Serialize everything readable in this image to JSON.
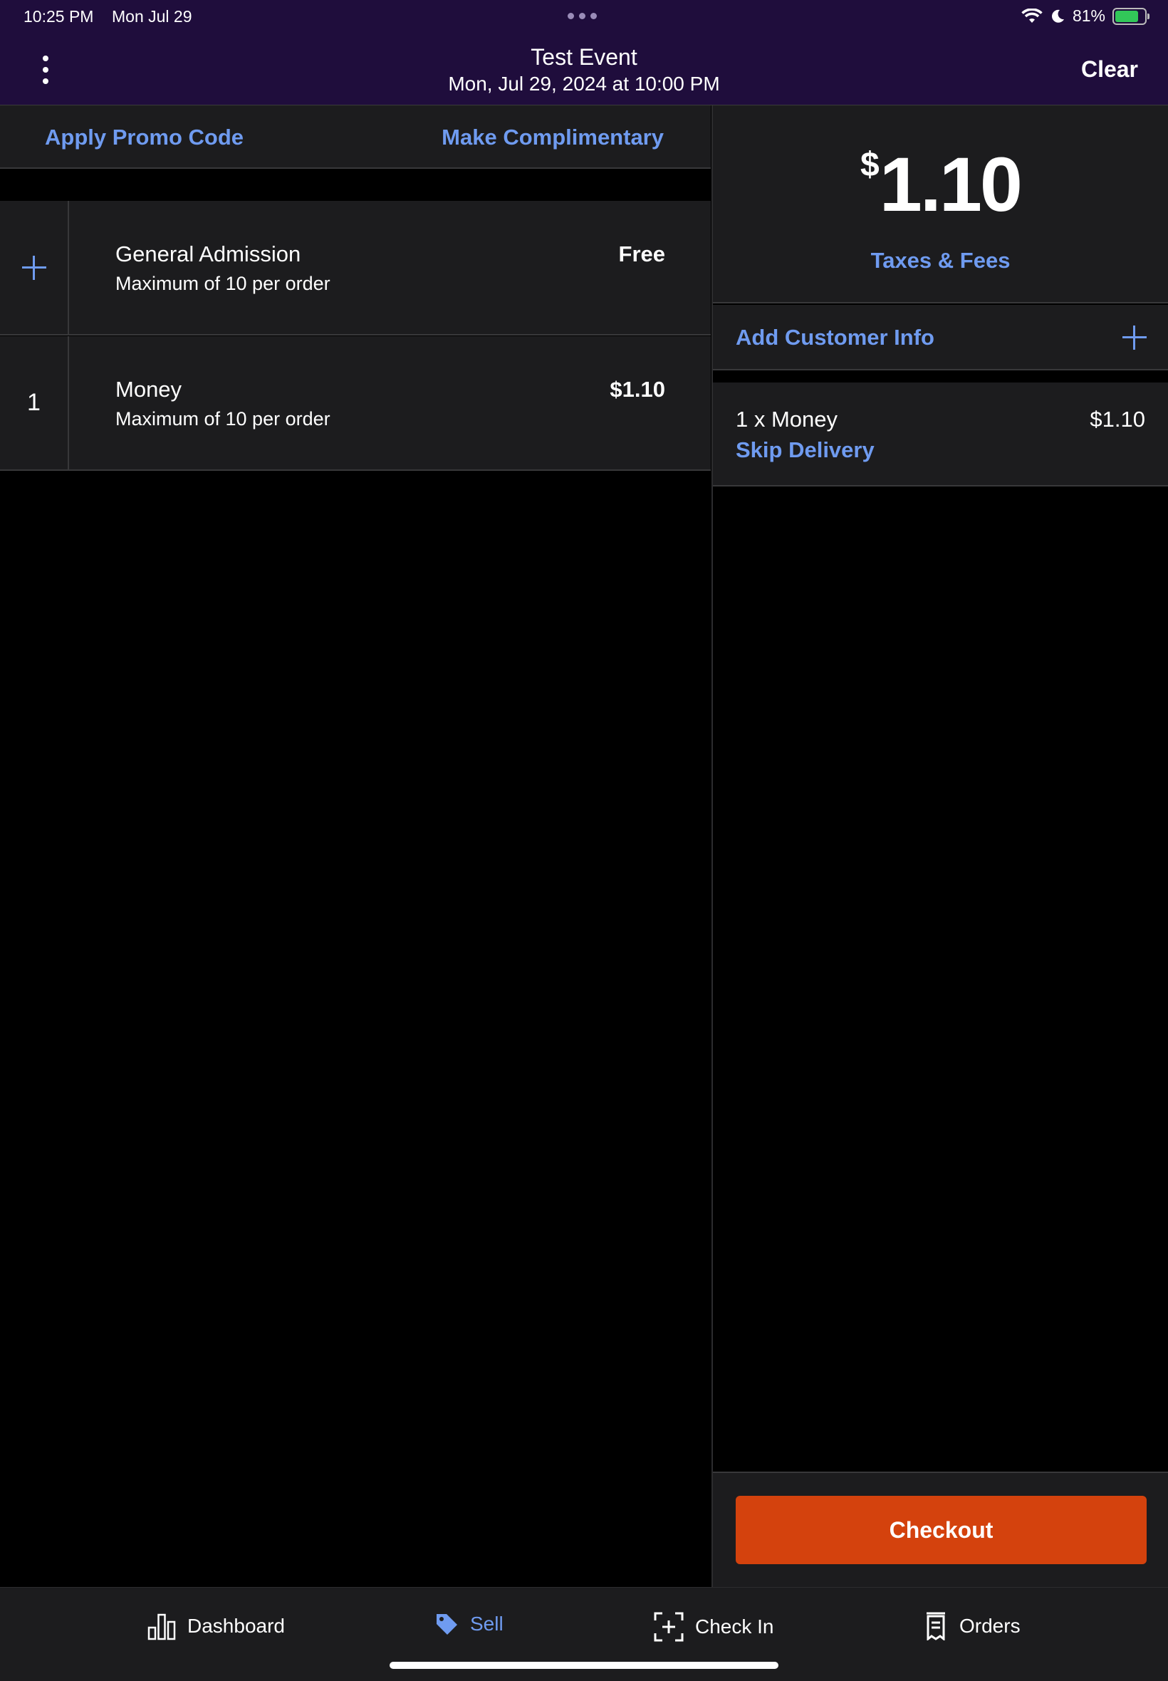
{
  "status_bar": {
    "time": "10:25 PM",
    "date": "Mon Jul 29",
    "battery": "81%",
    "battery_level": 0.81
  },
  "header": {
    "title": "Test Event",
    "subtitle": "Mon, Jul 29, 2024 at 10:00 PM",
    "clear_label": "Clear"
  },
  "actions": {
    "promo_label": "Apply Promo Code",
    "complimentary_label": "Make Complimentary"
  },
  "tickets": [
    {
      "quantity": "",
      "name": "General Admission",
      "limit": "Maximum of 10 per order",
      "price": "Free"
    },
    {
      "quantity": "1",
      "name": "Money",
      "limit": "Maximum of 10 per order",
      "price": "$1.10"
    }
  ],
  "summary": {
    "currency_symbol": "$",
    "total_amount": "1.10",
    "taxes_label": "Taxes & Fees",
    "add_customer_label": "Add Customer Info",
    "line_item": {
      "description": "1 x Money",
      "amount": "$1.10",
      "delivery_label": "Skip Delivery"
    },
    "checkout_label": "Checkout"
  },
  "tabs": [
    {
      "label": "Dashboard",
      "icon": "bar-chart-icon",
      "active": false
    },
    {
      "label": "Sell",
      "icon": "tag-icon",
      "active": true
    },
    {
      "label": "Check In",
      "icon": "scan-icon",
      "active": false
    },
    {
      "label": "Orders",
      "icon": "receipt-icon",
      "active": false
    }
  ],
  "colors": {
    "header_bg": "#1f0d3c",
    "accent": "#6f9bf0",
    "checkout": "#d4420d",
    "panel": "#1c1c1e"
  }
}
